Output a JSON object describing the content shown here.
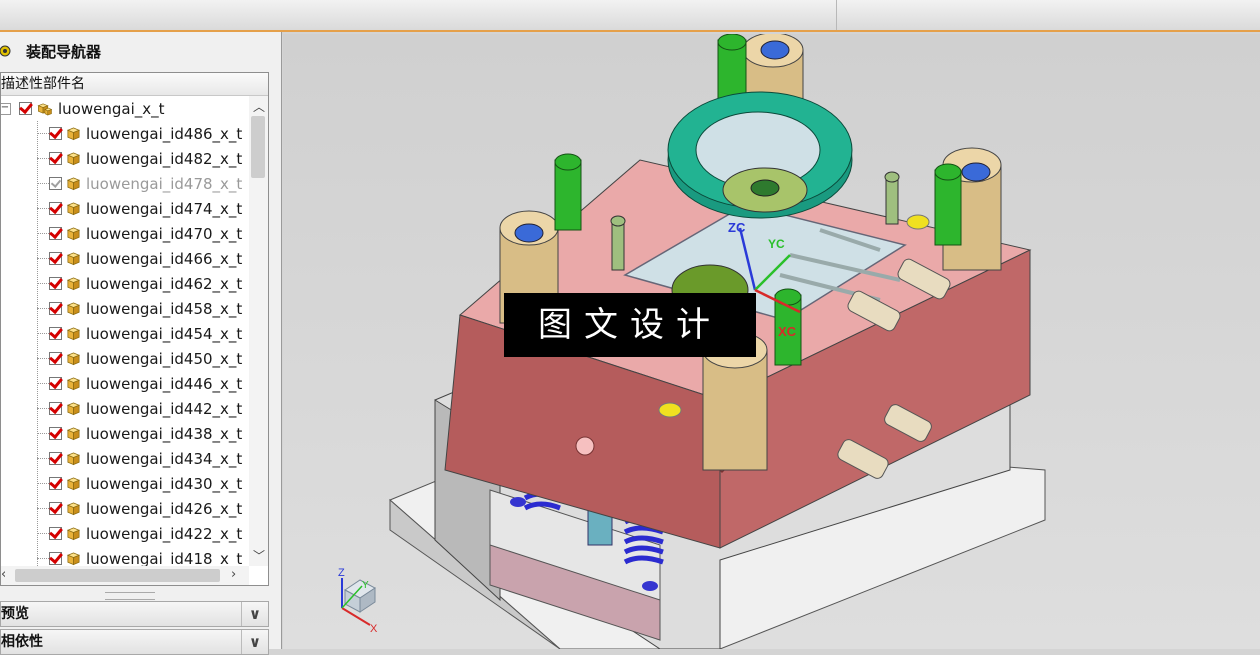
{
  "navigator": {
    "title": "装配导航器",
    "column_header": "描述性部件名",
    "root": {
      "label": "luowengai_x_t",
      "checked": true
    },
    "items": [
      {
        "label": "luowengai_id486_x_t",
        "state": "on"
      },
      {
        "label": "luowengai_id482_x_t",
        "state": "on"
      },
      {
        "label": "luowengai_id478_x_t",
        "state": "dim"
      },
      {
        "label": "luowengai_id474_x_t",
        "state": "on"
      },
      {
        "label": "luowengai_id470_x_t",
        "state": "on"
      },
      {
        "label": "luowengai_id466_x_t",
        "state": "on"
      },
      {
        "label": "luowengai_id462_x_t",
        "state": "on"
      },
      {
        "label": "luowengai_id458_x_t",
        "state": "on"
      },
      {
        "label": "luowengai_id454_x_t",
        "state": "on"
      },
      {
        "label": "luowengai_id450_x_t",
        "state": "on"
      },
      {
        "label": "luowengai_id446_x_t",
        "state": "on"
      },
      {
        "label": "luowengai_id442_x_t",
        "state": "on"
      },
      {
        "label": "luowengai_id438_x_t",
        "state": "on"
      },
      {
        "label": "luowengai_id434_x_t",
        "state": "on"
      },
      {
        "label": "luowengai_id430_x_t",
        "state": "on"
      },
      {
        "label": "luowengai_id426_x_t",
        "state": "on"
      },
      {
        "label": "luowengai_id422_x_t",
        "state": "on"
      },
      {
        "label": "luowengai_id418_x_t",
        "state": "on"
      }
    ],
    "sections": [
      {
        "label": "预览"
      },
      {
        "label": "相依性"
      }
    ]
  },
  "viewport": {
    "csys_labels": {
      "zc": "ZC",
      "yc": "YC",
      "xc": "XC"
    },
    "triad_labels": {
      "z": "Z",
      "y": "Y",
      "x": "X"
    },
    "watermark": "图文设计"
  },
  "colors": {
    "plate_top": "#e9a6a6",
    "plate_side": "#b45a5a",
    "ring": "#1ea58a",
    "bolt": "#2cb52c",
    "bushing": "#dcc38c",
    "spring": "#3a3ad8",
    "accent": "#e5a04a"
  }
}
